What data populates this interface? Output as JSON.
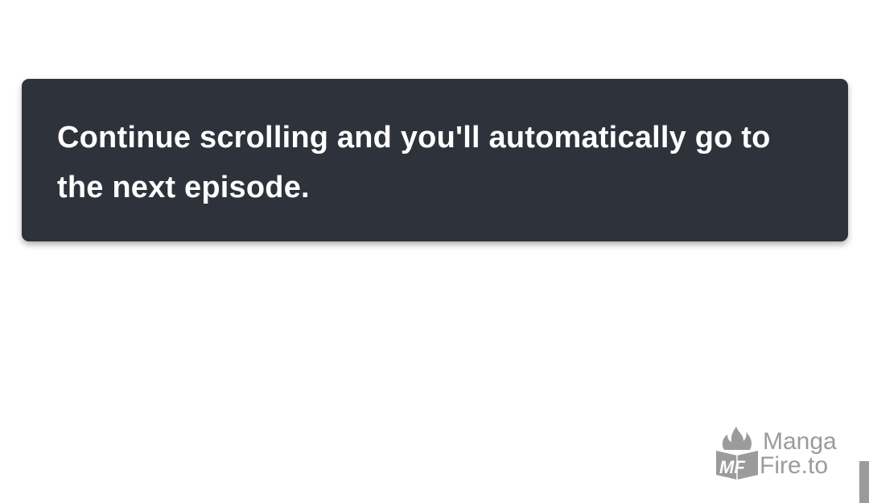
{
  "notice": {
    "message": "Continue scrolling and you'll automatically go to the next episode."
  },
  "watermark": {
    "logo_letters": "MF",
    "line1": "Manga",
    "line2": "Fire.to",
    "icon": "flame-book-logo-icon",
    "color": "#8a8a8a"
  },
  "colors": {
    "background": "#ffffff",
    "toast": "#2e323b",
    "toast_text": "#ffffff",
    "scrollbar": "#9b9b9b"
  }
}
